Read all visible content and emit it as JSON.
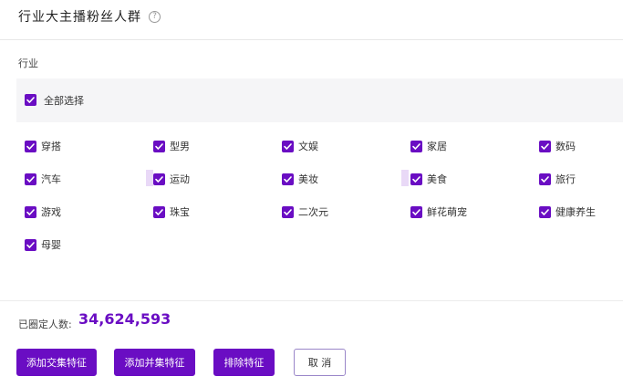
{
  "header": {
    "title": "行业大主播粉丝人群",
    "help_glyph": "?"
  },
  "section": {
    "label": "行业",
    "select_all_label": "全部选择"
  },
  "industries": [
    {
      "label": "穿搭",
      "checked": true
    },
    {
      "label": "型男",
      "checked": true
    },
    {
      "label": "文娱",
      "checked": true
    },
    {
      "label": "家居",
      "checked": true
    },
    {
      "label": "数码",
      "checked": true
    },
    {
      "label": "汽车",
      "checked": true
    },
    {
      "label": "运动",
      "checked": true
    },
    {
      "label": "美妆",
      "checked": true
    },
    {
      "label": "美食",
      "checked": true
    },
    {
      "label": "旅行",
      "checked": true
    },
    {
      "label": "游戏",
      "checked": true
    },
    {
      "label": "珠宝",
      "checked": true
    },
    {
      "label": "二次元",
      "checked": true
    },
    {
      "label": "鲜花萌宠",
      "checked": true
    },
    {
      "label": "健康养生",
      "checked": true
    },
    {
      "label": "母婴",
      "checked": true
    }
  ],
  "footer": {
    "count_label": "已圈定人数:",
    "count_value": "34,624,593",
    "buttons": {
      "intersect": "添加交集特征",
      "union": "添加并集特征",
      "exclude": "排除特征",
      "cancel": "取 消"
    }
  },
  "colors": {
    "accent": "#6a0dc3",
    "checkbox": "#6a0dc3"
  }
}
